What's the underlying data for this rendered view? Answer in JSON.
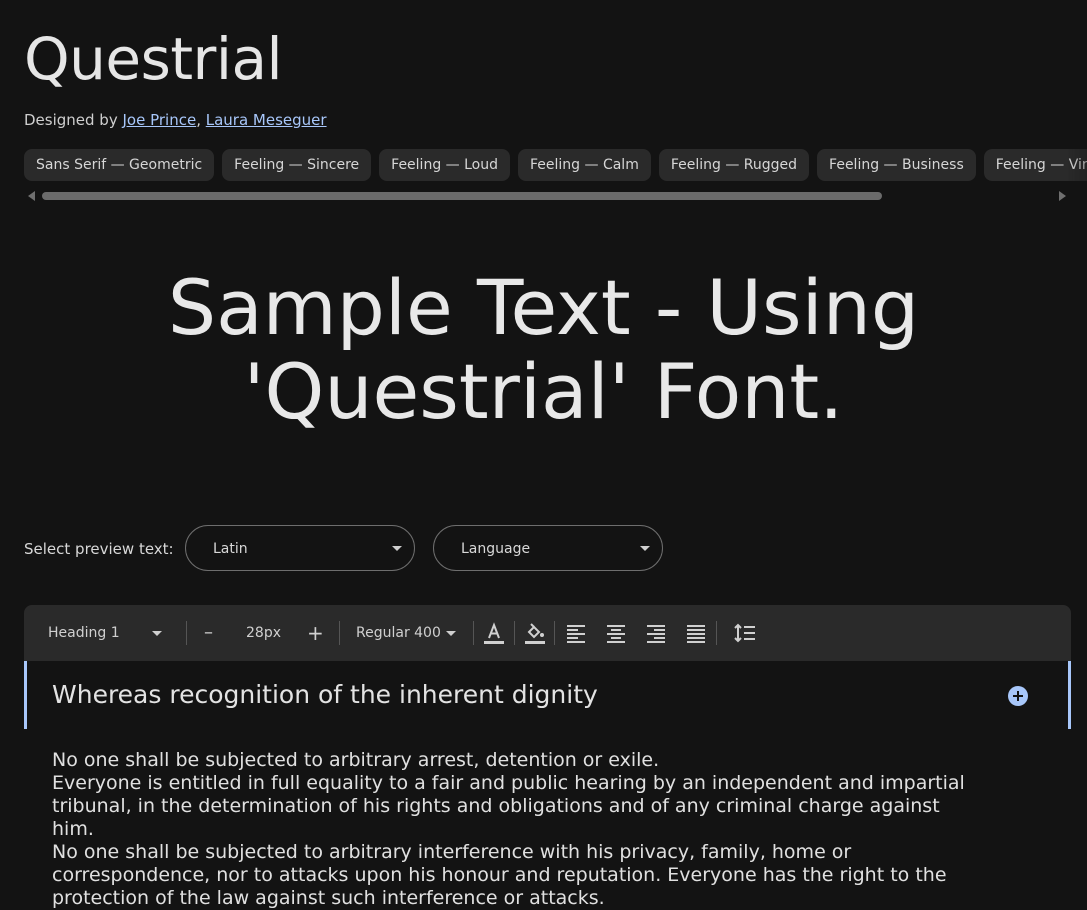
{
  "font": {
    "name": "Questrial",
    "designed_by_prefix": "Designed by ",
    "designers": [
      "Joe Prince",
      "Laura Meseguer"
    ],
    "designer_separator": ", "
  },
  "tags": [
    "Sans Serif — Geometric",
    "Feeling — Sincere",
    "Feeling — Loud",
    "Feeling — Calm",
    "Feeling — Rugged",
    "Feeling — Business",
    "Feeling — Vintage"
  ],
  "sample": {
    "text": "Sample Text - Using 'Questrial' Font."
  },
  "preview": {
    "label": "Select preview text:",
    "script_select": "Latin",
    "language_select": "Language"
  },
  "toolbar": {
    "style": "Heading 1",
    "decrease": "–",
    "size": "28px",
    "increase": "+",
    "weight": "Regular 400"
  },
  "editor": {
    "heading": "Whereas recognition of the inherent dignity",
    "paragraphs": [
      "No one shall be subjected to arbitrary arrest, detention or exile.",
      "Everyone is entitled in full equality to a fair and public hearing by an independent and impartial tribunal, in the determination of his rights and obligations and of any criminal charge against him.",
      "No one shall be subjected to arbitrary interference with his privacy, family, home or correspondence, nor to attacks upon his honour and reputation. Everyone has the right to the protection of the law against such interference or attacks."
    ]
  },
  "colors": {
    "background": "#131313",
    "surface": "#2a2a2a",
    "accent": "#a8c7fa",
    "text": "#e3e3e3"
  },
  "icons": {
    "text_color": "text-color-icon",
    "highlight": "fill-color-icon",
    "align_left": "align-left-icon",
    "align_center": "align-center-icon",
    "align_right": "align-right-icon",
    "align_justify": "align-justify-icon",
    "line_height": "line-height-icon",
    "add": "add-circle-icon"
  }
}
